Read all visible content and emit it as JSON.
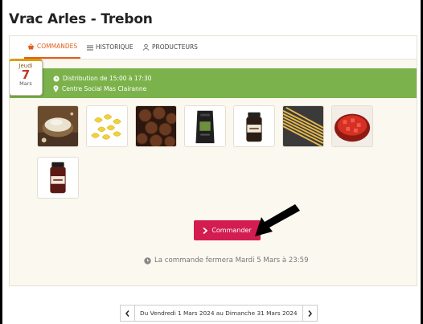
{
  "header": {
    "title": "Vrac Arles - Trebon"
  },
  "tabs": [
    {
      "label": "COMMANDES",
      "icon": "basket-icon",
      "active": true
    },
    {
      "label": "HISTORIQUE",
      "icon": "list-icon",
      "active": false
    },
    {
      "label": "PRODUCTEURS",
      "icon": "users-icon",
      "active": false
    }
  ],
  "distribution": {
    "date": {
      "weekday": "Jeudi",
      "day": "7",
      "month": "Mars"
    },
    "time": "Distribution de 15:00 à 17:30",
    "place": "Centre Social Mas Clairanne"
  },
  "products": [
    {
      "icon": "flour-bowl-icon"
    },
    {
      "icon": "pasta-icon"
    },
    {
      "icon": "chocolate-icon"
    },
    {
      "icon": "coffee-bag-icon"
    },
    {
      "icon": "jar-icon"
    },
    {
      "icon": "spaghetti-icon"
    },
    {
      "icon": "tomato-bowl-icon"
    },
    {
      "icon": "sauce-jar-icon"
    }
  ],
  "order": {
    "button_label": "Commander",
    "closing_note": "La commande fermera Mardi 5 Mars à 23:59"
  },
  "pager": {
    "range": "Du Vendredi 1 Mars 2024 au Dimanche 31 Mars 2024"
  },
  "colors": {
    "accent": "#e65c1a",
    "green_bar": "#7cb24b",
    "button": "#d31c4f",
    "date_day": "#c0392b"
  }
}
